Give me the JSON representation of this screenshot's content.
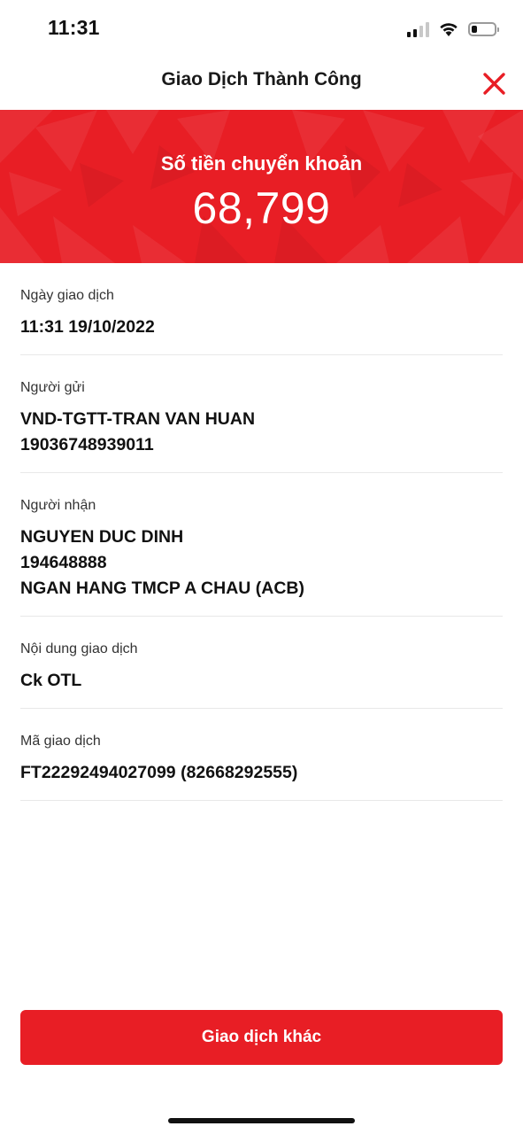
{
  "status_bar": {
    "time": "11:31",
    "icons": [
      "signal-icon",
      "wifi-icon",
      "battery-icon"
    ]
  },
  "header": {
    "title": "Giao Dịch Thành Công",
    "close_icon": "close-icon"
  },
  "banner": {
    "label": "Số tiền chuyển khoản",
    "amount": "68,799"
  },
  "details": [
    {
      "label": "Ngày giao dịch",
      "values": [
        "11:31 19/10/2022"
      ]
    },
    {
      "label": "Người gửi",
      "values": [
        "VND-TGTT-TRAN VAN HUAN",
        "19036748939011"
      ]
    },
    {
      "label": "Người nhận",
      "values": [
        "NGUYEN DUC DINH",
        "194648888",
        "NGAN HANG TMCP A CHAU (ACB)"
      ]
    },
    {
      "label": "Nội dung giao dịch",
      "values": [
        "Ck OTL"
      ]
    },
    {
      "label": "Mã giao dịch",
      "values": [
        "FT22292494027099 (82668292555)"
      ]
    }
  ],
  "action_button": {
    "label": "Giao dịch khác"
  },
  "colors": {
    "brand_red": "#e81e25",
    "text": "#111111",
    "divider": "#e8e8e8"
  }
}
